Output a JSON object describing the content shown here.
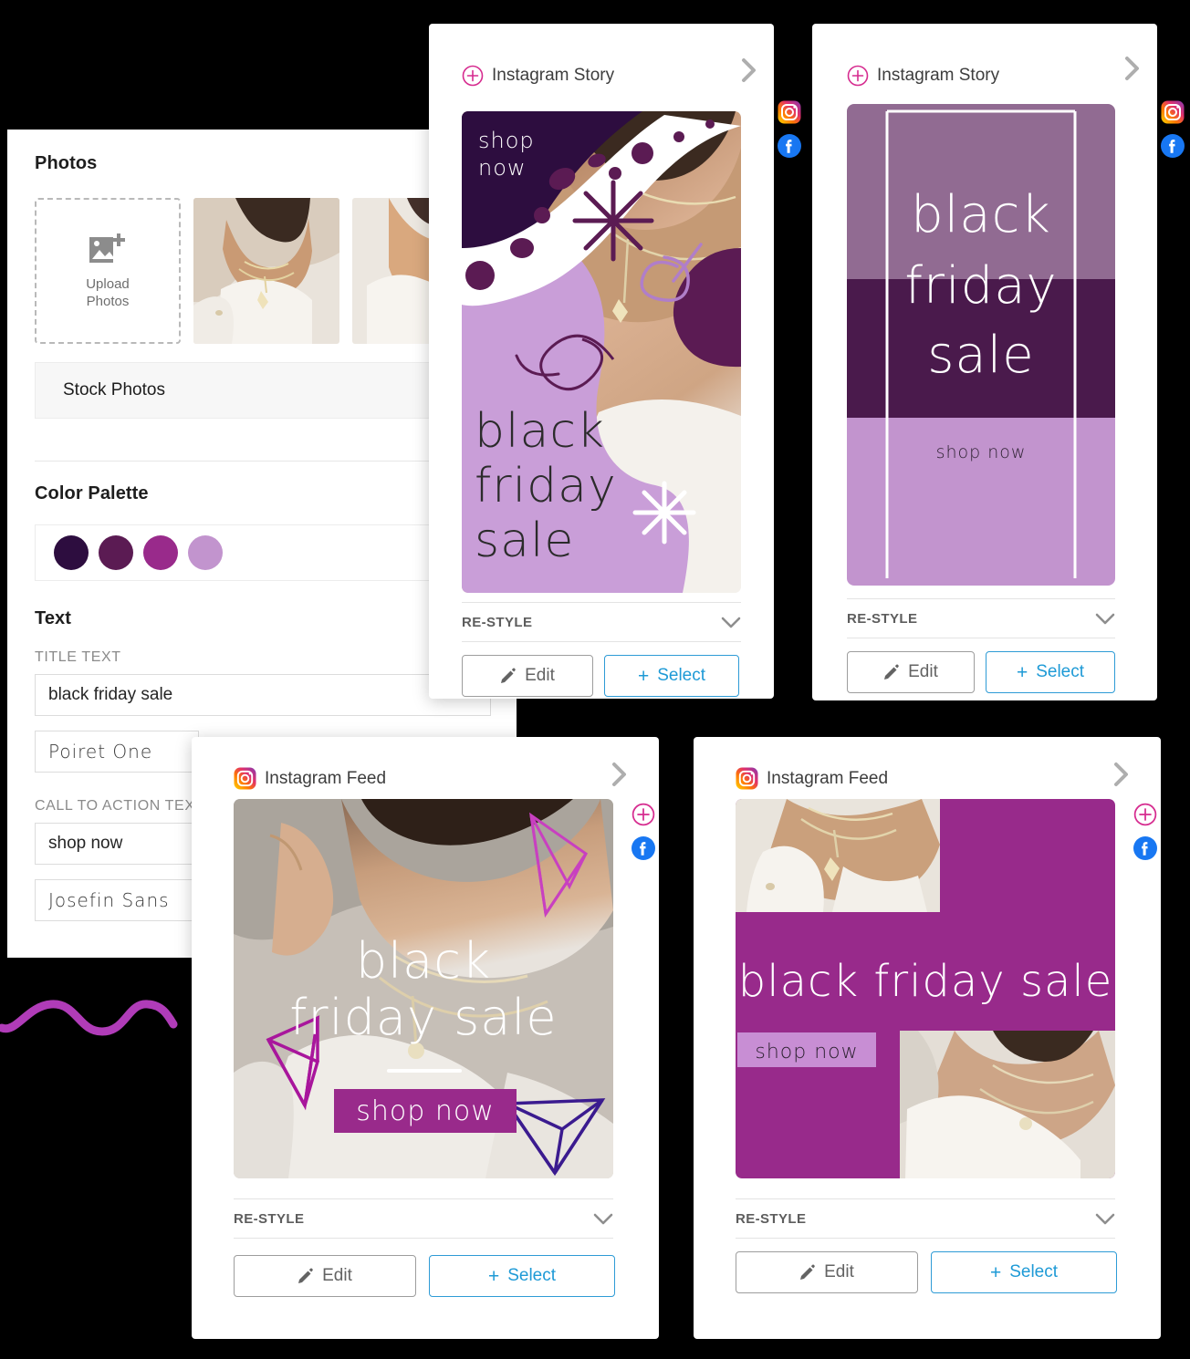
{
  "editor": {
    "photos": {
      "title": "Photos",
      "upload_label_line1": "Upload",
      "upload_label_line2": "Photos",
      "upload_icon": "image-plus-icon",
      "stock_photos_label": "Stock Photos"
    },
    "color_palette": {
      "title": "Color Palette",
      "swatches": [
        "#2d0d3f",
        "#5b1b53",
        "#992a8b",
        "#c294ce"
      ]
    },
    "text": {
      "title": "Text",
      "title_text_label": "TITLE TEXT",
      "title_text_value": "black friday sale",
      "title_font_value": "Poiret One",
      "cta_label": "CALL TO ACTION TEXT",
      "cta_value": "shop now",
      "cta_font_value": "Josefin Sans"
    }
  },
  "common": {
    "restyle_label": "RE-STYLE",
    "edit_label": "Edit",
    "select_label": "Select",
    "select_plus": "+",
    "edit_icon": "pencil-icon",
    "chevron_down_icon": "chevron-down-icon",
    "chevron_right_icon": "chevron-right-icon",
    "instagram_icon": "instagram-icon",
    "facebook_icon": "facebook-icon",
    "plus_circle_icon": "plus-circle-icon",
    "accent_blue": "#1e9ad6",
    "accent_pink": "#d62b8f"
  },
  "cards": [
    {
      "platform_label": "Instagram Story",
      "head_icon": "plus-circle-icon",
      "social_icons": [
        "instagram-icon",
        "facebook-icon"
      ],
      "design": {
        "style": "organic-blob-photo",
        "cta_text": "shop now",
        "title_lines": [
          "black",
          "friday",
          "sale"
        ],
        "colors": {
          "dark": "#2d0d3f",
          "plum": "#5b1b53",
          "lilac": "#c99ed8",
          "white": "#ffffff"
        }
      }
    },
    {
      "platform_label": "Instagram Story",
      "head_icon": "plus-circle-icon",
      "social_icons": [
        "instagram-icon",
        "facebook-icon"
      ],
      "design": {
        "style": "three-band-frame",
        "title_lines": [
          "black",
          "friday",
          "sale"
        ],
        "cta_text": "shop now",
        "colors": {
          "band_top": "#916b92",
          "band_mid": "#4a1a4c",
          "band_bottom": "#c294ce"
        }
      }
    },
    {
      "platform_label": "Instagram Feed",
      "head_icon": "instagram-icon",
      "social_icons": [
        "plus-circle-icon",
        "facebook-icon"
      ],
      "design": {
        "style": "photo-overlay-gems",
        "title_lines": [
          "black",
          "friday sale"
        ],
        "cta_text": "shop now",
        "colors": {
          "cta_bg": "#992a8b",
          "gem_pink": "#c840c0",
          "gem_magenta": "#a8169c",
          "gem_navy": "#3b1b8f"
        }
      }
    },
    {
      "platform_label": "Instagram Feed",
      "head_icon": "instagram-icon",
      "social_icons": [
        "plus-circle-icon",
        "facebook-icon"
      ],
      "design": {
        "style": "collage-blocks",
        "title_text": "black friday sale",
        "cta_text": "shop now",
        "colors": {
          "bg": "#982a8b",
          "cta_bg": "#c88ed4"
        }
      }
    }
  ]
}
